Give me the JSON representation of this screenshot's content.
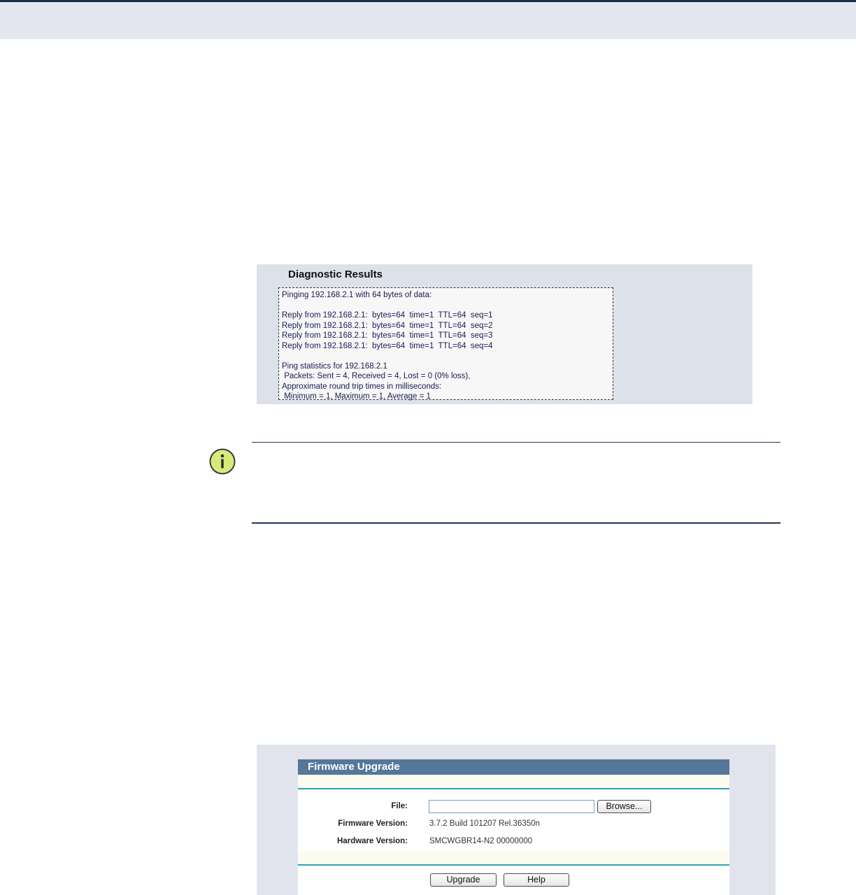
{
  "diagnostic": {
    "title": "Diagnostic Results",
    "lines": [
      "Pinging 192.168.2.1 with 64 bytes of data:",
      "",
      "Reply from 192.168.2.1:  bytes=64  time=1  TTL=64  seq=1",
      "Reply from 192.168.2.1:  bytes=64  time=1  TTL=64  seq=2",
      "Reply from 192.168.2.1:  bytes=64  time=1  TTL=64  seq=3",
      "Reply from 192.168.2.1:  bytes=64  time=1  TTL=64  seq=4",
      "",
      "Ping statistics for 192.168.2.1",
      " Packets: Sent = 4, Received = 4, Lost = 0 (0% loss),",
      "Approximate round trip times in milliseconds:",
      " Minimum = 1, Maximum = 1, Average = 1"
    ]
  },
  "note": {
    "icon": "info-icon",
    "icon_color": "#d8ea7a"
  },
  "firmware": {
    "title": "Firmware Upgrade",
    "file_label": "File:",
    "file_value": "",
    "browse_label": "Browse...",
    "firmware_version_label": "Firmware Version:",
    "firmware_version_value": "3.7.2 Build 101207 Rel.36350n",
    "hardware_version_label": "Hardware Version:",
    "hardware_version_value": "SMCWGBR14-N2 00000000",
    "upgrade_label": "Upgrade",
    "help_label": "Help"
  }
}
